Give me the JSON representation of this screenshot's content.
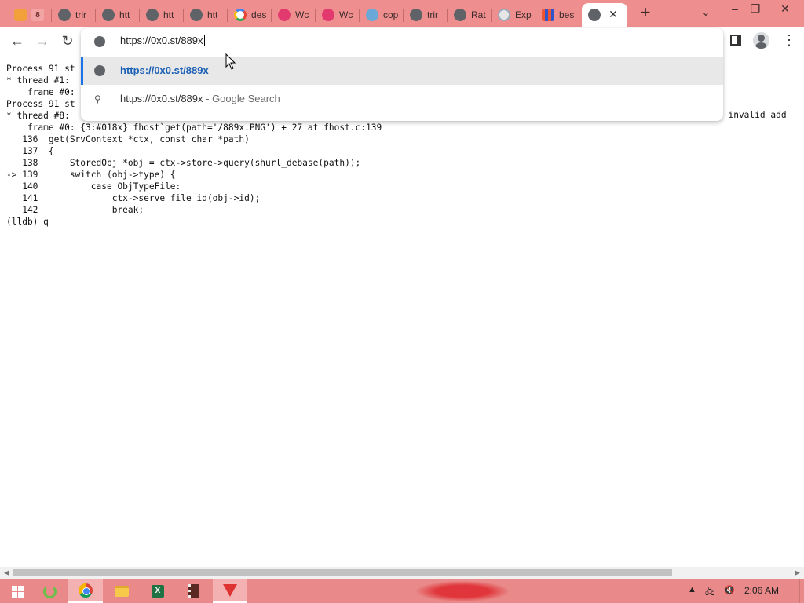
{
  "tabs": [
    {
      "title": "",
      "icon": "orange-face-icon",
      "left": 0
    },
    {
      "title": "trir",
      "icon": "globe-icon"
    },
    {
      "title": "htt",
      "icon": "globe-icon"
    },
    {
      "title": "htt",
      "icon": "globe-icon"
    },
    {
      "title": "htt",
      "icon": "globe-icon"
    },
    {
      "title": "des",
      "icon": "google-icon"
    },
    {
      "title": "Wc",
      "icon": "pink-flower-icon"
    },
    {
      "title": "Wc",
      "icon": "pink-flower-icon"
    },
    {
      "title": "cop",
      "icon": "dashboard-icon"
    },
    {
      "title": "trir",
      "icon": "globe-icon"
    },
    {
      "title": "Rat",
      "icon": "globe-icon"
    },
    {
      "title": "Exp",
      "icon": "swirl-icon"
    },
    {
      "title": "bes",
      "icon": "grid-icon"
    },
    {
      "title": "",
      "icon": "globe-icon",
      "active": true
    }
  ],
  "omnibox": {
    "input_text": "https://0x0.st/889x",
    "suggestion_1": "https://0x0.st/889x",
    "suggestion_2_query": "https://0x0.st/889x",
    "suggestion_2_suffix": " - Google Search"
  },
  "terminal": {
    "lines": [
      "Process 91 st",
      "* thread #1:",
      "    frame #0:",
      "Process 91 st",
      "* thread #8:",
      "    frame #0: {3:#018x} fhost`get(path='/889x.PNG') + 27 at fhost.c:139",
      "   136  get(SrvContext *ctx, const char *path)",
      "   137  {",
      "   138      StoredObj *obj = ctx->store->query(shurl_debase(path));",
      "-> 139      switch (obj->type) {",
      "   140          case ObjTypeFile:",
      "   141              ctx->serve_file_id(obj->id);",
      "   142              break;",
      "(lldb) q"
    ],
    "right_clip": "= invalid add"
  },
  "taskbar": {
    "clock": "2:06 AM"
  }
}
